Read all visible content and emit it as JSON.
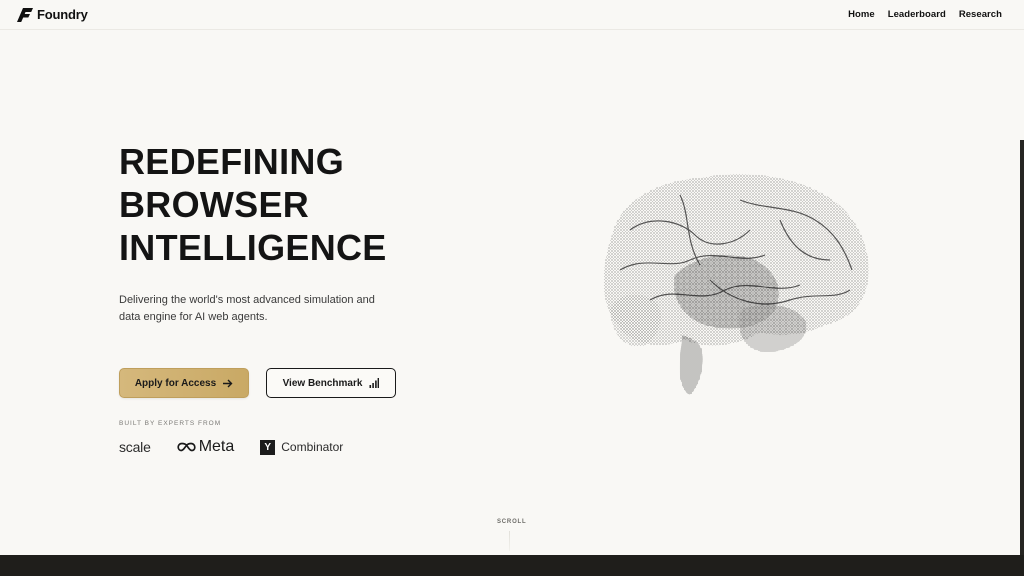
{
  "header": {
    "brand": "Foundry",
    "nav": [
      "Home",
      "Leaderboard",
      "Research"
    ]
  },
  "hero": {
    "title_lines": [
      "REDEFINING",
      "BROWSER",
      "INTELLIGENCE"
    ],
    "subtitle": "Delivering the world's most advanced simulation and data engine for AI web agents.",
    "primary_cta": "Apply for Access",
    "secondary_cta": "View Benchmark",
    "built_by": "BUILT BY EXPERTS FROM",
    "logos": {
      "scale": "scale",
      "meta": "Meta",
      "yc_mark": "Y",
      "yc": "Combinator"
    }
  },
  "scroll": "SCROLL",
  "icons": {
    "brand": "foundry-logo-icon",
    "primary_cta": "arrow-right-icon",
    "secondary_cta": "bar-chart-icon",
    "meta": "infinity-icon",
    "hero_graphic": "brain-point-cloud-icon"
  },
  "colors": {
    "background": "#f9f8f5",
    "primary_button": "#d5b87c",
    "text": "#141414",
    "footer": "#1f1e1b"
  }
}
